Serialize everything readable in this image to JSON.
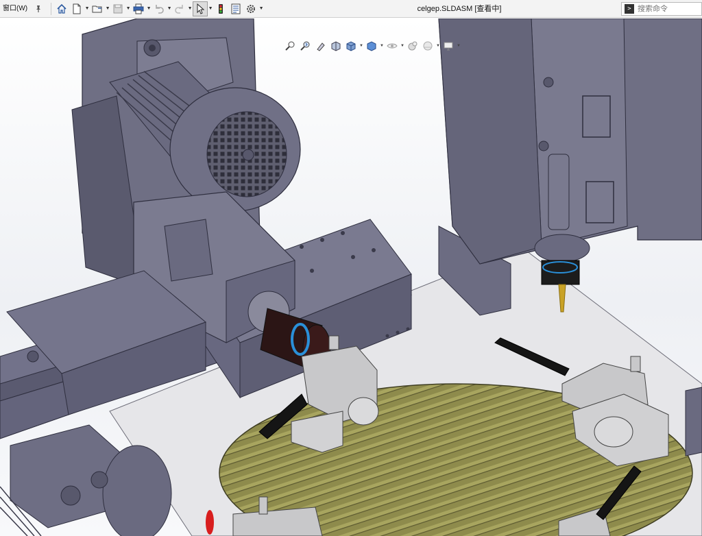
{
  "menu": {
    "window_label": "窗口(W)"
  },
  "toolbar": {
    "buttons": [
      {
        "icon": "home-icon"
      },
      {
        "icon": "new-file-icon"
      },
      {
        "icon": "open-folder-icon"
      },
      {
        "icon": "save-icon"
      },
      {
        "icon": "print-icon"
      },
      {
        "icon": "undo-icon"
      },
      {
        "icon": "redo-icon"
      },
      {
        "icon": "select-arrow-icon"
      },
      {
        "icon": "rebuild-traffic-light-icon"
      },
      {
        "icon": "file-properties-icon"
      },
      {
        "icon": "options-gear-icon"
      }
    ]
  },
  "document": {
    "title": "celgep.SLDASM [查看中]"
  },
  "search": {
    "placeholder": "搜索命令"
  },
  "heads_up_toolbar": {
    "buttons": [
      "zoom-to-fit-icon",
      "zoom-to-area-icon",
      "previous-view-icon",
      "section-view-icon",
      "view-orientation-icon",
      "display-style-icon",
      "hide-show-icon",
      "edit-appearance-icon",
      "apply-scene-icon",
      "view-settings-icon"
    ]
  },
  "colors": {
    "machine_body": "#6f6f80",
    "machine_dark": "#55556a",
    "table_green": "#8b8a4a",
    "clamp_metal": "#c8c8ca",
    "handle_black": "#1a1a1a",
    "spindle_black": "#2a1414",
    "accent_blue": "#2a8fd8"
  }
}
